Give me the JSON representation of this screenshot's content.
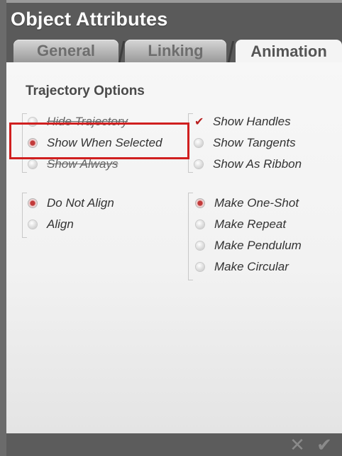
{
  "dialog": {
    "title": "Object Attributes"
  },
  "tabs": [
    {
      "label": "General",
      "active": false
    },
    {
      "label": "Linking",
      "active": false
    },
    {
      "label": "Animation",
      "active": true
    }
  ],
  "section": {
    "title": "Trajectory Options"
  },
  "trajectory_display": [
    {
      "label": "Hide Trajectory",
      "selected": false
    },
    {
      "label": "Show When Selected",
      "selected": true
    },
    {
      "label": "Show Always",
      "selected": false
    }
  ],
  "trajectory_extras": [
    {
      "label": "Show Handles",
      "checked": true
    },
    {
      "label": "Show Tangents",
      "checked": false
    },
    {
      "label": "Show As Ribbon",
      "checked": false
    }
  ],
  "alignment": [
    {
      "label": "Do Not Align",
      "selected": true
    },
    {
      "label": "Align",
      "selected": false
    }
  ],
  "playback": [
    {
      "label": "Make One-Shot",
      "selected": true
    },
    {
      "label": "Make Repeat",
      "selected": false
    },
    {
      "label": "Make Pendulum",
      "selected": false
    },
    {
      "label": "Make Circular",
      "selected": false
    }
  ],
  "footer": {
    "cancel_icon": "close-icon",
    "confirm_icon": "checkmark-icon",
    "cancel_glyph": "✕",
    "confirm_glyph": "✔"
  },
  "colors": {
    "accent": "#c23a3a",
    "highlight_box": "#d01f1f",
    "title_bar": "#5a5a5a"
  }
}
